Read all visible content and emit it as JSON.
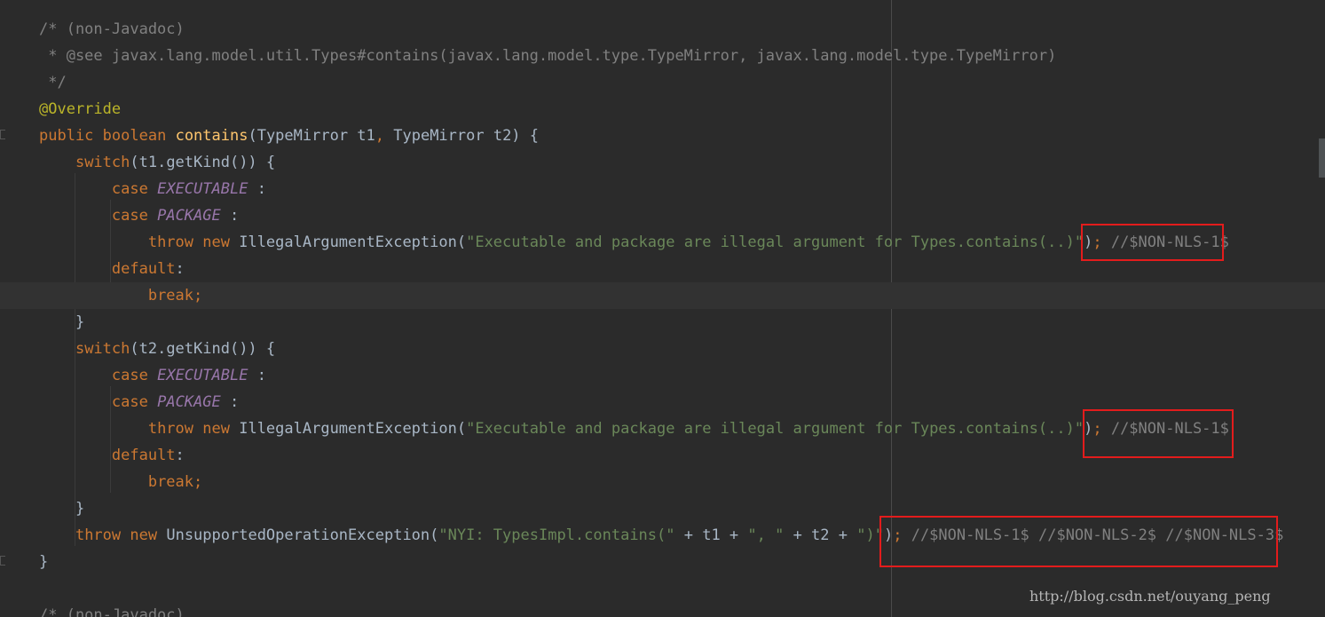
{
  "editor": {
    "current_line": 11,
    "lines": [
      "/* (non-Javadoc)",
      " * @see javax.lang.model.util.Types#contains(javax.lang.model.type.TypeMirror, javax.lang.model.type.TypeMirror)",
      " */",
      "@Override",
      "public boolean contains(TypeMirror t1, TypeMirror t2) {",
      "    switch(t1.getKind()) {",
      "        case EXECUTABLE :",
      "        case PACKAGE :",
      "            throw new IllegalArgumentException(\"Executable and package are illegal argument for Types.contains(..)\"); //$NON-NLS-1$",
      "        default:",
      "            break;",
      "    }",
      "    switch(t2.getKind()) {",
      "        case EXECUTABLE :",
      "        case PACKAGE :",
      "            throw new IllegalArgumentException(\"Executable and package are illegal argument for Types.contains(..)\"); //$NON-NLS-1$",
      "        default:",
      "            break;",
      "    }",
      "    throw new UnsupportedOperationException(\"NYI: TypesImpl.contains(\" + t1 + \", \" + t2 + \")\"); //$NON-NLS-1$ //$NON-NLS-2$ //$NON-NLS-3$",
      "}",
      "",
      "/* (non-Javadoc)"
    ]
  },
  "highlights": [
    {
      "line": 9,
      "label": "//$NON-NLS-1$"
    },
    {
      "line": 16,
      "label": "//$NON-NLS-1$"
    },
    {
      "line": 20,
      "label": "//$NON-NLS-1$ //$NON-NLS-2$ //$NON-NLS-3$"
    }
  ],
  "watermark": "http://blog.csdn.net/ouyang_peng",
  "colors": {
    "background": "#2b2b2b",
    "keyword": "#cc7832",
    "annotation": "#bbb529",
    "method": "#ffc66d",
    "string": "#6a8759",
    "comment": "#808080",
    "constant": "#9876aa",
    "highlight_box": "#e31c1c"
  }
}
